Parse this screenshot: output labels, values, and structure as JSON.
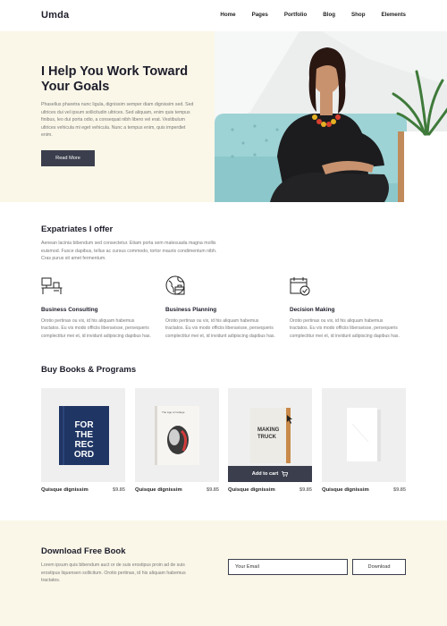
{
  "nav": {
    "logo": "Umda",
    "items": [
      "Home",
      "Pages",
      "Portfolio",
      "Blog",
      "Shop",
      "Elements"
    ]
  },
  "hero": {
    "title": "I Help You Work Toward Your Goals",
    "text": "Phasellus pharetra nunc ligula, dignissim semper diam dignissim sed. Sed ultrices dui vel ipsum sollicitudin ultrices. Sed aliquam, enim quis tempus finibus, leo dui porta odio, a consequat nibh libero vel erat. Vestibulum ultrices vehicula mi eget vehicula. Nunc a tempus enim, quis imperdiet enim.",
    "button": "Read More"
  },
  "offer": {
    "title": "Expatriates I offer",
    "text": "Aenean lacinia bibendum sed consectetur. Etiam porta sem malesuada magna mollis euismod. Fusce dapibus, tellus ac cursus commodo, tortor mauris condimentum nibh. Cras purus sit amet fermentum.",
    "services": [
      {
        "icon": "desk-workstation-icon",
        "title": "Business Consulting",
        "text": "Orotio pertinax ou vix, id his aliquam habemus tractatos. Eu vis modo officiis liberavisse, persequeris complectitur mei et, id invidunt adipiscing dapibus has."
      },
      {
        "icon": "globe-briefcase-icon",
        "title": "Business Planning",
        "text": "Orotio pertinax ou vix, id his aliquam habemus tractatos. Eu vis modo officiis liberavisse, persequeris complectitur mei et, id invidunt adipiscing dapibus has."
      },
      {
        "icon": "calendar-check-icon",
        "title": "Decision Making",
        "text": "Orotio pertinax ou vix, id his aliquam habemus tractatos. Eu vis modo officiis liberavisse, persequeris complectitur mei et, id invidunt adipiscing dapibus has."
      }
    ]
  },
  "books": {
    "title": "Buy Books & Programs",
    "add_to_cart": "Add to cart",
    "items": [
      {
        "name": "Quisque dignissim",
        "price": "$9.85",
        "cover_text": "FOR THE REC ORD"
      },
      {
        "name": "Quisque dignissim",
        "price": "$9.85",
        "cover_text": "The Age of College"
      },
      {
        "name": "Quisque dignissim",
        "price": "$9.85",
        "cover_text": "MAKING TRUCK"
      },
      {
        "name": "Quisque dignissim",
        "price": "$9.85",
        "cover_text": ""
      }
    ]
  },
  "download": {
    "title": "Download Free Book",
    "text": "Lorem ipsum quis bibendum auct or de suis erostipus proin ad de suis erostipus liquensen sollicitum. Orotio pertinax, id his aliquam habemus tractatos.",
    "email_placeholder": "Your Email",
    "button": "Download"
  },
  "colors": {
    "accent_dark": "#3b3f4d",
    "cream": "#faf7e8"
  }
}
